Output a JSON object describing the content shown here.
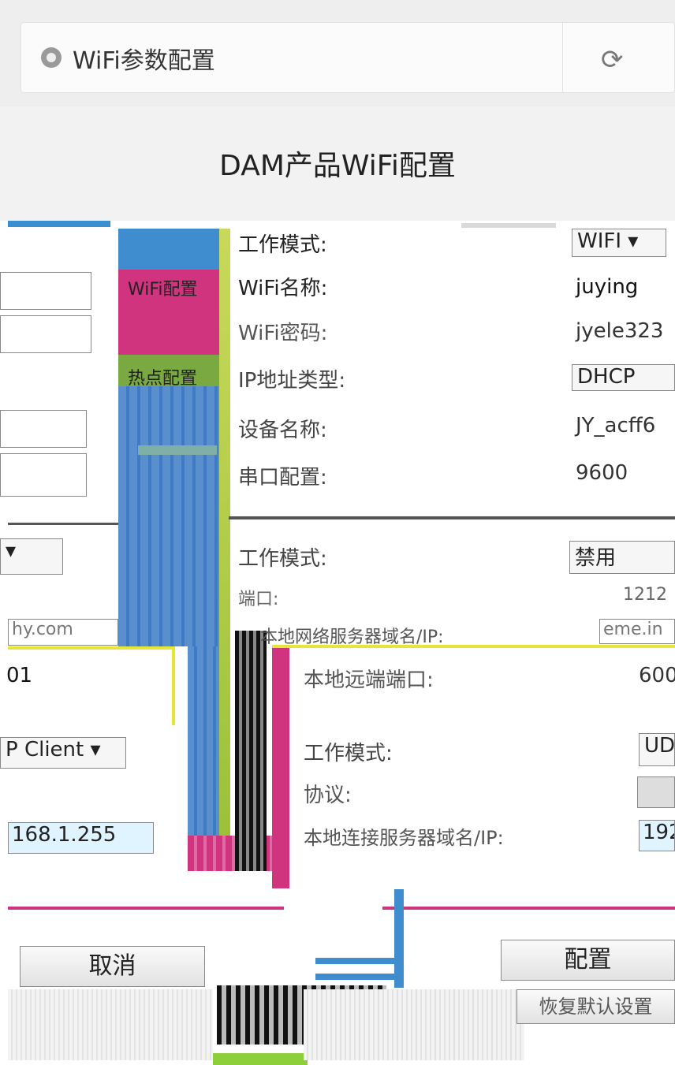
{
  "browser": {
    "page_title": "WiFi参数配置",
    "reload_icon": "reload-icon"
  },
  "header": {
    "title": "DAM产品WiFi配置"
  },
  "tabs": [
    {
      "label": "WiFi配置"
    },
    {
      "label": "热点配置"
    }
  ],
  "wifi_section": {
    "work_mode_label": "工作模式:",
    "work_mode_value": "WIFI ▾",
    "wifi_name_label": "WiFi名称:",
    "wifi_name_value": "juying",
    "wifi_password_label": "WiFi密码:",
    "wifi_password_value": "jyele323",
    "ip_type_label": "IP地址类型:",
    "ip_type_value": "DHCP",
    "device_name_label": "设备名称:",
    "device_name_value": "JY_acff6",
    "serial_label": "串口配置:",
    "serial_value": "9600"
  },
  "server_section": {
    "work_mode_label": "工作模式:",
    "work_mode_value": "禁用",
    "left_select_value": "▾",
    "port_label": "端口:",
    "port_value": "1212",
    "domain_label": "本地网络服务器域名/IP:",
    "left_domain_value": "hy.com",
    "right_domain_value": "eme.in",
    "local_port_label": "本地远端端口:",
    "left_port_value": "01",
    "right_port_value": "600"
  },
  "udp_section": {
    "left_mode_value": "P Client ▾",
    "work_mode_label": "工作模式:",
    "work_mode_value": "UD",
    "protocol_label": "协议:",
    "remote_ip_label": "本地连接服务器域名/IP:",
    "left_ip_value": "168.1.255",
    "right_ip_value": "192"
  },
  "actions": {
    "cancel_label": "取消",
    "configure_label": "配置",
    "restore_label": "恢复默认设置"
  }
}
